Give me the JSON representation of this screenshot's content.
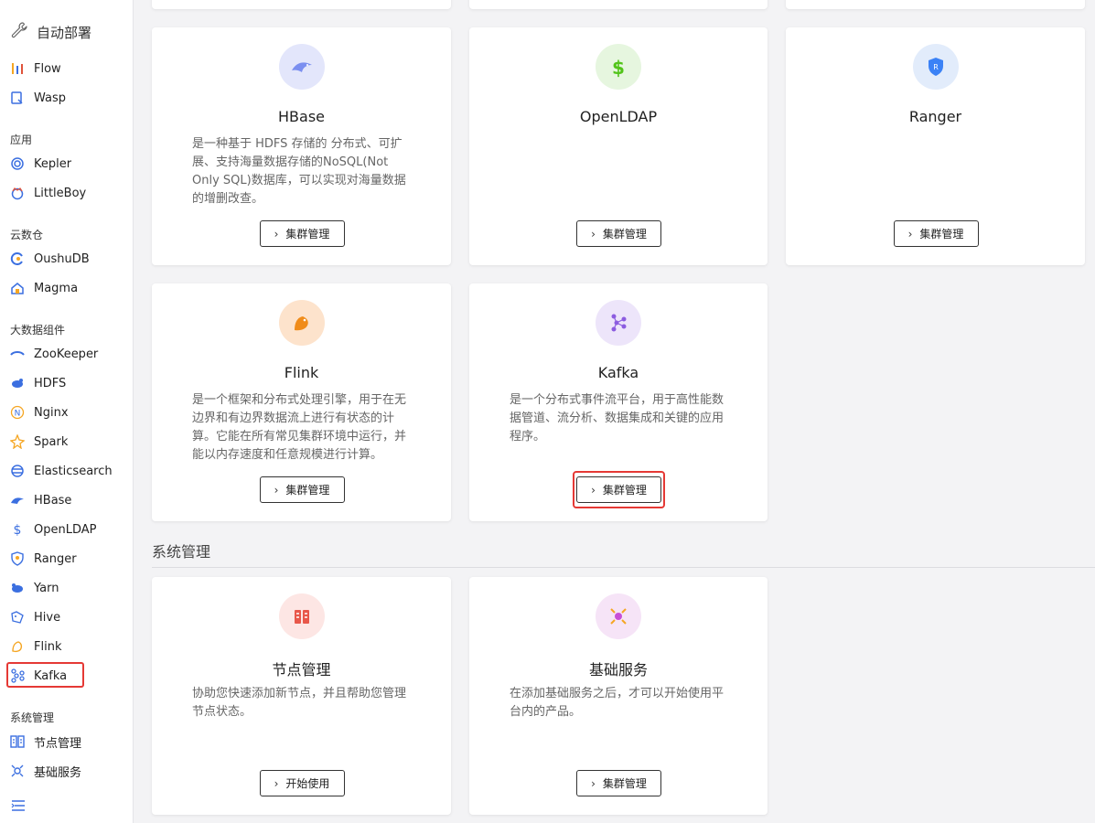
{
  "sidebar": {
    "brand": "自动部署",
    "items_top": [
      {
        "label": "Flow",
        "icon": "flow-icon"
      },
      {
        "label": "Wasp",
        "icon": "wasp-icon"
      }
    ],
    "section_apps": "应用",
    "items_apps": [
      {
        "label": "Kepler",
        "icon": "kepler-icon"
      },
      {
        "label": "LittleBoy",
        "icon": "littleboy-icon"
      }
    ],
    "section_warehouse": "云数仓",
    "items_warehouse": [
      {
        "label": "OushuDB",
        "icon": "oushudb-icon"
      },
      {
        "label": "Magma",
        "icon": "magma-icon"
      }
    ],
    "section_bigdata": "大数据组件",
    "items_bigdata": [
      {
        "label": "ZooKeeper",
        "icon": "zookeeper-icon"
      },
      {
        "label": "HDFS",
        "icon": "hdfs-icon"
      },
      {
        "label": "Nginx",
        "icon": "nginx-icon"
      },
      {
        "label": "Spark",
        "icon": "spark-icon"
      },
      {
        "label": "Elasticsearch",
        "icon": "elasticsearch-icon"
      },
      {
        "label": "HBase",
        "icon": "hbase-icon"
      },
      {
        "label": "OpenLDAP",
        "icon": "openldap-icon"
      },
      {
        "label": "Ranger",
        "icon": "ranger-icon"
      },
      {
        "label": "Yarn",
        "icon": "yarn-icon"
      },
      {
        "label": "Hive",
        "icon": "hive-icon"
      },
      {
        "label": "Flink",
        "icon": "flink-icon"
      },
      {
        "label": "Kafka",
        "icon": "kafka-icon"
      }
    ],
    "section_system": "系统管理",
    "items_system": [
      {
        "label": "节点管理",
        "icon": "node-management-icon"
      },
      {
        "label": "基础服务",
        "icon": "base-service-icon"
      }
    ]
  },
  "cards": {
    "hbase": {
      "title": "HBase",
      "desc": "是一种基于 HDFS 存储的 分布式、可扩展、支持海量数据存储的NoSQL(Not Only SQL)数据库，可以实现对海量数据的增删改查。",
      "button": "集群管理"
    },
    "openldap": {
      "title": "OpenLDAP",
      "desc": "",
      "button": "集群管理"
    },
    "ranger": {
      "title": "Ranger",
      "desc": "",
      "button": "集群管理"
    },
    "flink": {
      "title": "Flink",
      "desc": "是一个框架和分布式处理引擎，用于在无边界和有边界数据流上进行有状态的计算。它能在所有常见集群环境中运行，并能以内存速度和任意规模进行计算。",
      "button": "集群管理"
    },
    "kafka": {
      "title": "Kafka",
      "desc": "是一个分布式事件流平台，用于高性能数据管道、流分析、数据集成和关键的应用程序。",
      "button": "集群管理"
    },
    "node": {
      "title": "节点管理",
      "desc": "协助您快速添加新节点，并且帮助您管理节点状态。",
      "button": "开始使用"
    },
    "base": {
      "title": "基础服务",
      "desc": "在添加基础服务之后，才可以开始使用平台内的产品。",
      "button": "集群管理"
    }
  },
  "section_system_title": "系统管理",
  "colors": {
    "highlight": "#e53935",
    "hbase_bg": "#e3e6fb",
    "openldap_bg": "#e6f6df",
    "ranger_bg": "#e2ecfb",
    "flink_bg": "#fde3cc",
    "kafka_bg": "#ede5fa",
    "node_bg": "#fde6e4",
    "base_bg": "#f6e4f7"
  }
}
